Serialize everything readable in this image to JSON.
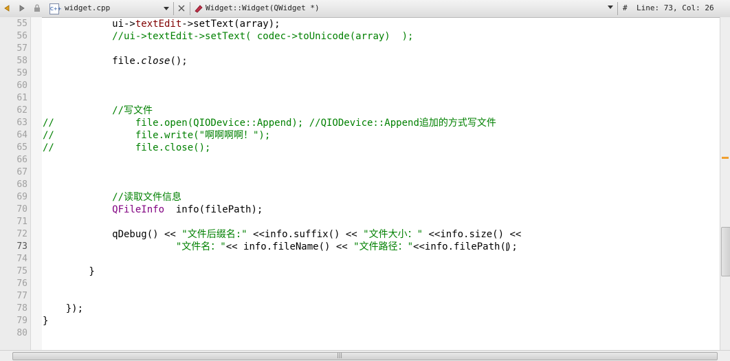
{
  "toolbar": {
    "file_name": "widget.cpp",
    "function_name": "Widget::Widget(QWidget *)",
    "hash": "#",
    "line_info": "Line: 73, Col: 26",
    "file_icon_text": "C++"
  },
  "lines": [
    {
      "num": "55",
      "text": "            ui->textEdit->setText(array);"
    },
    {
      "num": "56",
      "text": "            //ui->textEdit->setText( codec->toUnicode(array)  );"
    },
    {
      "num": "57",
      "text": ""
    },
    {
      "num": "58",
      "text": "            file.close();"
    },
    {
      "num": "59",
      "text": ""
    },
    {
      "num": "60",
      "text": ""
    },
    {
      "num": "61",
      "text": ""
    },
    {
      "num": "62",
      "text": "            //写文件"
    },
    {
      "num": "63",
      "text": "//              file.open(QIODevice::Append); //QIODevice::Append追加的方式写文件"
    },
    {
      "num": "64",
      "text": "//              file.write(\"啊啊啊啊！\");"
    },
    {
      "num": "65",
      "text": "//              file.close();"
    },
    {
      "num": "66",
      "text": ""
    },
    {
      "num": "67",
      "text": ""
    },
    {
      "num": "68",
      "text": ""
    },
    {
      "num": "69",
      "text": "            //读取文件信息"
    },
    {
      "num": "70",
      "text": "            QFileInfo  info(filePath);"
    },
    {
      "num": "71",
      "text": ""
    },
    {
      "num": "72",
      "text": "            qDebug() << \"文件后缀名:\" <<info.suffix() << \"文件大小：\" <<info.size() <<"
    },
    {
      "num": "73",
      "text": "                       \"文件名：\"<< info.fileName() << \"文件路径：\"<<info.filePath();"
    },
    {
      "num": "74",
      "text": ""
    },
    {
      "num": "75",
      "text": "        }"
    },
    {
      "num": "76",
      "text": ""
    },
    {
      "num": "77",
      "text": ""
    },
    {
      "num": "78",
      "text": "    });"
    },
    {
      "num": "79",
      "text": "}"
    },
    {
      "num": "80",
      "text": ""
    }
  ],
  "current_line": "73",
  "colors": {
    "comment": "#008000",
    "member": "#800000",
    "class": "#800080",
    "string": "#008000"
  }
}
